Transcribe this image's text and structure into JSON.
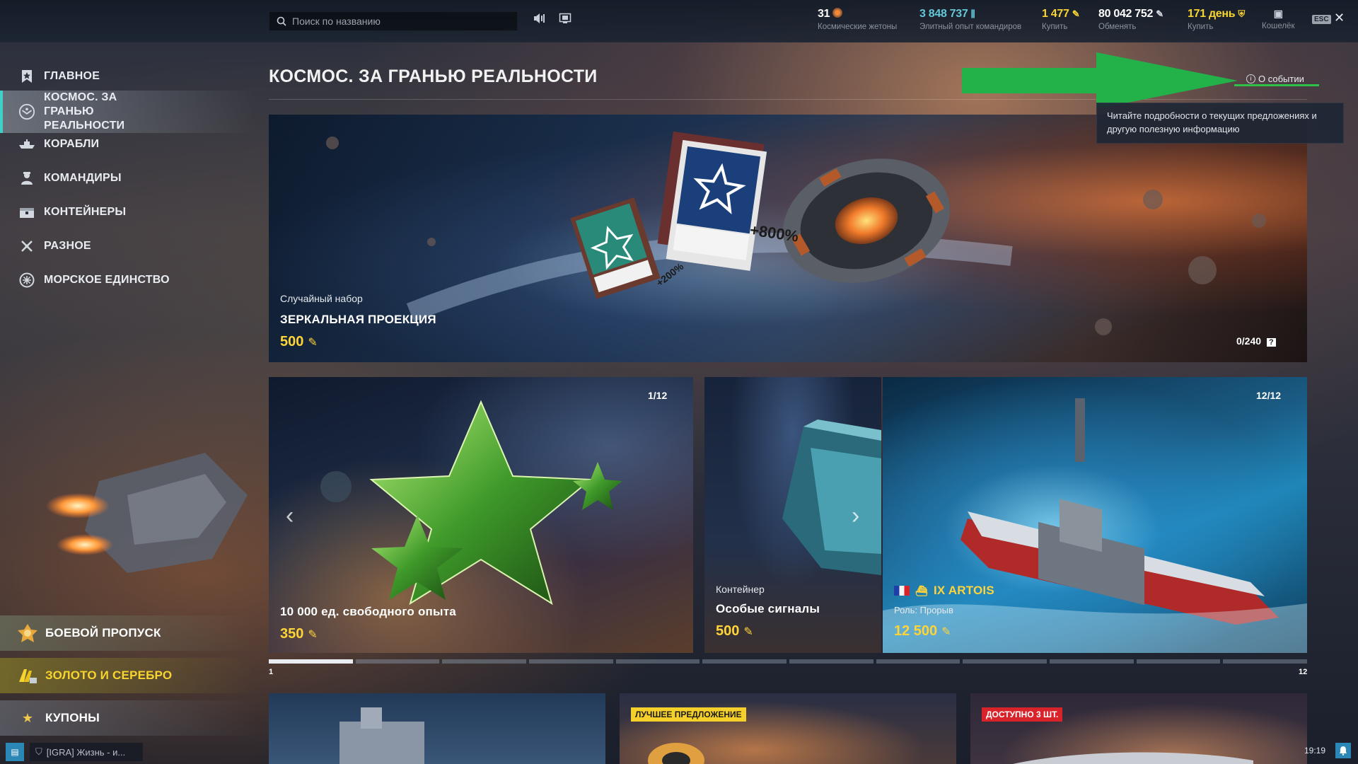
{
  "topbar": {
    "search_placeholder": "Поиск по названию",
    "currencies": [
      {
        "value": "31",
        "label": "Космические жетоны",
        "color": "#ffffff",
        "icon": "space-token-icon"
      },
      {
        "value": "3 848 737",
        "label": "Элитный опыт командиров",
        "color": "#63c7d8",
        "icon": "elite-commander-xp-icon"
      },
      {
        "value": "1 477",
        "label": "Купить",
        "color": "#f7d430",
        "icon": "doubloon-icon"
      },
      {
        "value": "80 042 752",
        "label": "Обменять",
        "color": "#ffffff",
        "icon": "credits-icon"
      },
      {
        "value": "171 день",
        "label": "Купить",
        "color": "#f7d430",
        "icon": "premium-account-icon"
      },
      {
        "value": "",
        "label": "Кошелёк",
        "color": "#ffffff",
        "icon": "wallet-icon"
      }
    ],
    "esc_label": "ESC"
  },
  "sidebar": {
    "items": [
      {
        "label": "ГЛАВНОЕ",
        "icon": "bookmark-icon"
      },
      {
        "label": "КОСМОС. ЗА ГРАНЬЮ РЕАЛЬНОСТИ",
        "icon": "space-event-icon",
        "active": true
      },
      {
        "label": "КОРАБЛИ",
        "icon": "ship-icon"
      },
      {
        "label": "КОМАНДИРЫ",
        "icon": "commander-icon"
      },
      {
        "label": "КОНТЕЙНЕРЫ",
        "icon": "container-icon"
      },
      {
        "label": "РАЗНОЕ",
        "icon": "misc-icon"
      },
      {
        "label": "МОРСКОЕ ЕДИНСТВО",
        "icon": "naval-unity-icon"
      }
    ],
    "promos": [
      {
        "label": "БОЕВОЙ ПРОПУСК",
        "icon": "battle-pass-icon"
      },
      {
        "label": "ЗОЛОТО И СЕРЕБРО",
        "icon": "gold-silver-icon"
      },
      {
        "label": "КУПОНЫ",
        "icon": "star-icon"
      }
    ],
    "clan_text": "[IGRA] Жизнь - и..."
  },
  "main": {
    "title": "КОСМОС. ЗА ГРАНЬЮ РЕАЛЬНОСТИ",
    "about_link": "О событии",
    "tooltip": "Читайте подробности о текущих предложениях и другую полезную информацию",
    "hero": {
      "subtitle": "Случайный набор",
      "title": "ЗЕРКАЛЬНАЯ ПРОЕКЦИЯ",
      "price": "500",
      "counter": "0/240",
      "badge_200": "+200%",
      "badge_800": "+800%"
    },
    "cards": [
      {
        "title": "10 000 ед. свободного опыта",
        "price": "350",
        "counter": "1/12"
      },
      {
        "subtitle": "Контейнер",
        "title": "Особые сигналы",
        "price": "500"
      },
      {
        "title": "IX ARTOIS",
        "role": "Роль: Прорыв",
        "price": "12 500",
        "counter": "12/12"
      }
    ],
    "pager": {
      "current": 1,
      "total": 12,
      "left": "1",
      "right": "12"
    },
    "bottom_badges": {
      "best": "ЛУЧШЕЕ ПРЕДЛОЖЕНИЕ",
      "available": "ДОСТУПНО 3 ШТ."
    },
    "clock": "19:19"
  }
}
